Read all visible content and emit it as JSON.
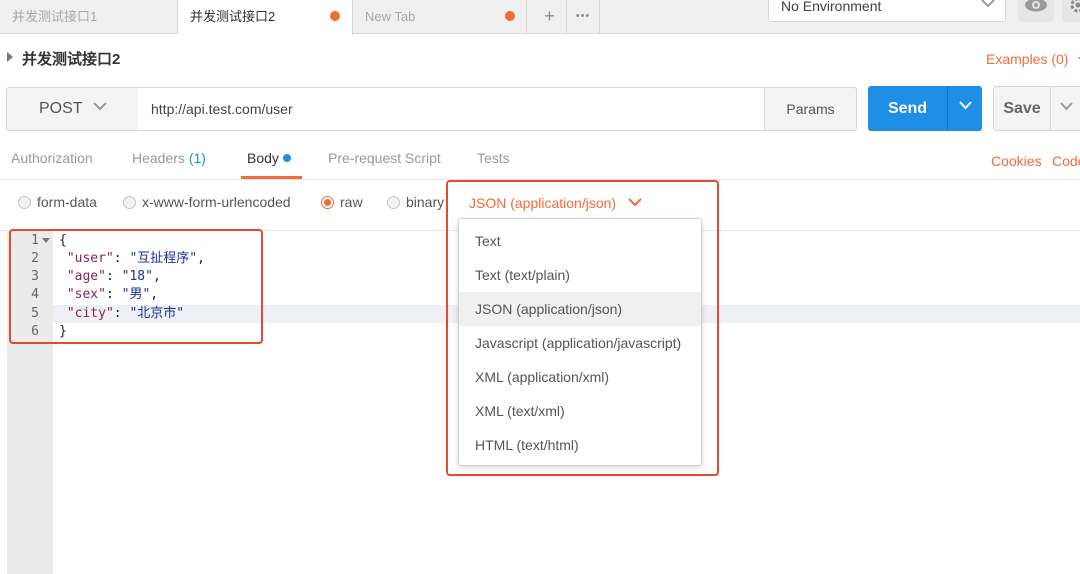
{
  "tabs": [
    {
      "label": "并发测试接口1",
      "active": false,
      "unsaved": false
    },
    {
      "label": "并发测试接口2",
      "active": true,
      "unsaved": true
    },
    {
      "label": "New Tab",
      "active": false,
      "unsaved": true
    }
  ],
  "tab_tools": {
    "add": "+",
    "more": "•••"
  },
  "environment": {
    "selected": "No Environment"
  },
  "request": {
    "name": "并发测试接口2",
    "examples_label": "Examples (0)",
    "method": "POST",
    "url": "http://api.test.com/user",
    "params_label": "Params",
    "send_label": "Send",
    "save_label": "Save"
  },
  "subtabs": {
    "authorization": "Authorization",
    "headers": "Headers",
    "headers_count": "(1)",
    "body": "Body",
    "pre_request": "Pre-request Script",
    "tests": "Tests",
    "cookies": "Cookies",
    "code": "Code"
  },
  "body_types": {
    "form_data": "form-data",
    "urlencoded": "x-www-form-urlencoded",
    "raw": "raw",
    "binary": "binary",
    "selected": "raw"
  },
  "content_type": {
    "selected": "JSON (application/json)",
    "options": [
      "Text",
      "Text (text/plain)",
      "JSON (application/json)",
      "Javascript (application/javascript)",
      "XML (application/xml)",
      "XML (text/xml)",
      "HTML (text/html)"
    ]
  },
  "editor": {
    "line_numbers": [
      "1",
      "2",
      "3",
      "4",
      "5",
      "6"
    ],
    "code": {
      "open": "{",
      "user_key": "\"user\"",
      "user_val": "\"互扯程序\"",
      "age_key": "\"age\"",
      "age_val": "\"18\"",
      "sex_key": "\"sex\"",
      "sex_val": "\"男\"",
      "city_key": "\"city\"",
      "city_val": "\"北京市\"",
      "close": "}"
    }
  },
  "colors": {
    "accent_orange": "#f26b3a",
    "send_blue": "#1f8ee6",
    "annotation_red": "#e24a34"
  }
}
